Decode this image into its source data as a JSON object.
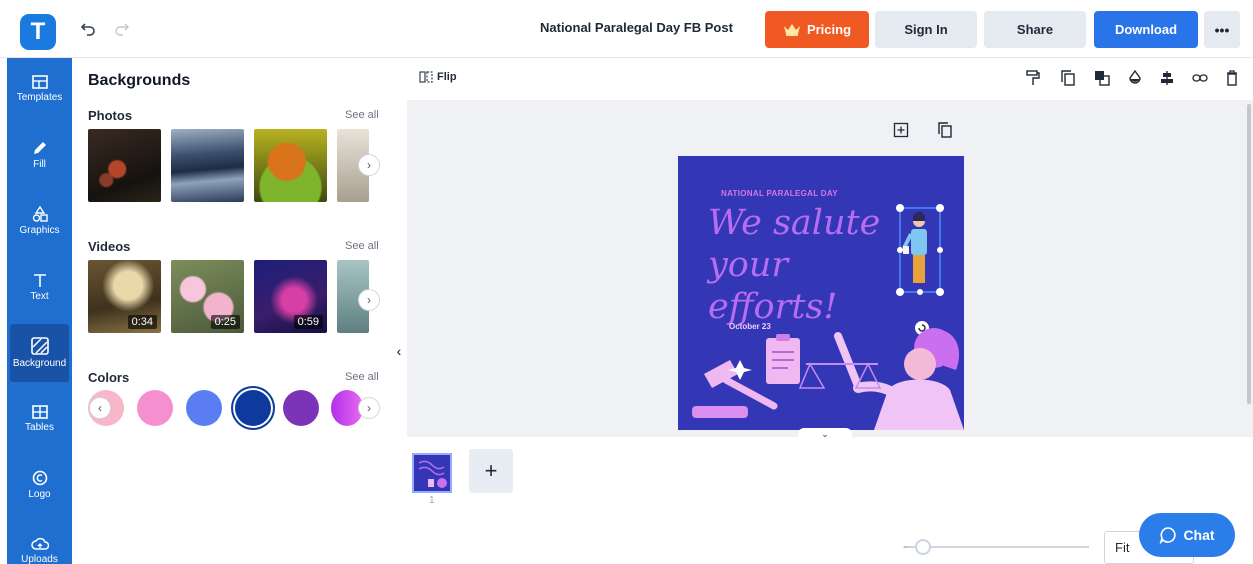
{
  "header": {
    "logo_letter": "T",
    "doc_title": "National Paralegal Day FB Post",
    "pricing_label": "Pricing",
    "signin_label": "Sign In",
    "share_label": "Share",
    "download_label": "Download",
    "more_label": "•••",
    "accent_color": "#f05a22",
    "download_color": "#2874e8"
  },
  "rail": {
    "items": [
      {
        "label": "Templates",
        "icon": "templates-icon"
      },
      {
        "label": "Fill",
        "icon": "pencil-icon"
      },
      {
        "label": "Graphics",
        "icon": "shapes-icon"
      },
      {
        "label": "Text",
        "icon": "text-icon"
      },
      {
        "label": "Background",
        "icon": "background-icon",
        "active": true
      },
      {
        "label": "Tables",
        "icon": "table-icon"
      },
      {
        "label": "Logo",
        "icon": "logo-icon"
      },
      {
        "label": "Uploads",
        "icon": "upload-cloud-icon"
      }
    ],
    "color": "#1e6fcf"
  },
  "panel": {
    "title": "Backgrounds",
    "photos": {
      "title": "Photos",
      "see_all": "See all"
    },
    "videos": {
      "title": "Videos",
      "see_all": "See all",
      "durations": [
        "0:34",
        "0:25",
        "0:59"
      ]
    },
    "colors": {
      "title": "Colors",
      "see_all": "See all",
      "swatches": [
        "#f6b7c9",
        "#f58fcf",
        "#5a7ef2",
        "#0d3a9c",
        "#7b34b8",
        "#b12fe8"
      ],
      "selected": "#0d3a9c"
    }
  },
  "toolbar": {
    "flip_label": "Flip",
    "tools": [
      "paint-roller-icon",
      "duplicate-icon",
      "layer-icon",
      "opacity-drop-icon",
      "align-icon",
      "link-icon",
      "trash-icon"
    ]
  },
  "design": {
    "eyebrow": "NATIONAL PARALEGAL DAY",
    "script_line1": "We salute",
    "script_line2": "your efforts!",
    "date": "October 23",
    "background": "#3437b5"
  },
  "pages": {
    "page_number": "1",
    "add_label": "+"
  },
  "zoom": {
    "fit_label": "Fit",
    "level": 0.05
  },
  "chat": {
    "label": "Chat"
  }
}
